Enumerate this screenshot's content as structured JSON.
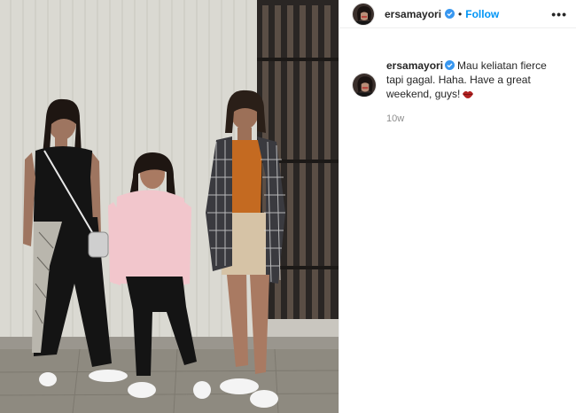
{
  "post": {
    "username": "ersamayori",
    "separator": "•",
    "follow_label": "Follow",
    "more_label": "•••",
    "caption": "Mau keliatan fierce tapi gagal. Haha. Have a great weekend, guys!",
    "timestamp": "10w",
    "verified_color": "#3897f0",
    "accent": "#0095f6"
  },
  "icons": {
    "verified": "verified-badge-icon",
    "more": "more-options-icon",
    "emoji": "lips-emoji-icon"
  }
}
